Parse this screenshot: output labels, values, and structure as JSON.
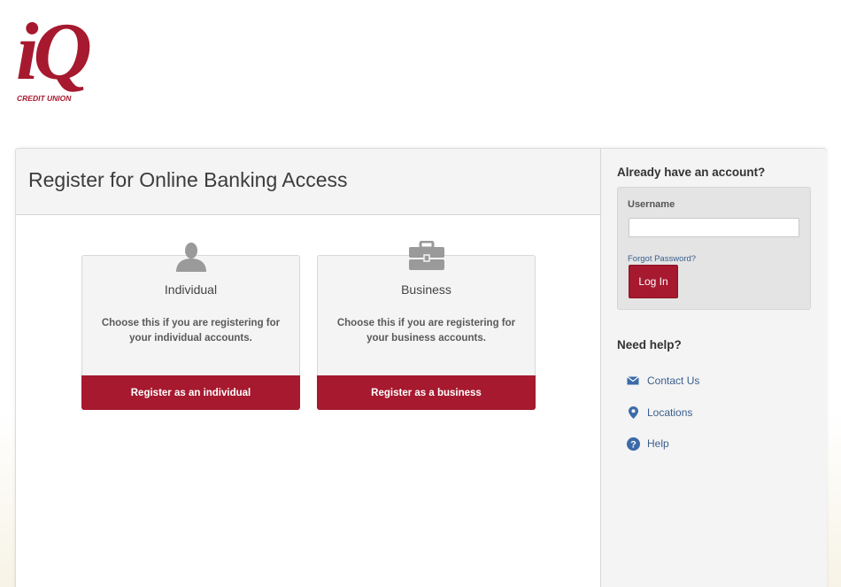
{
  "brand": {
    "logo_text": "iQ",
    "logo_subtext": "CREDIT UNION",
    "color": "#a6192e"
  },
  "main": {
    "title": "Register for Online Banking Access",
    "options": [
      {
        "icon": "person-icon",
        "title": "Individual",
        "description": "Choose this if you are registering for your individual accounts.",
        "button": "Register as an individual"
      },
      {
        "icon": "briefcase-icon",
        "title": "Business",
        "description": "Choose this if you are registering for your business accounts.",
        "button": "Register as a business"
      }
    ]
  },
  "sidebar": {
    "login_heading": "Already have an account?",
    "username_label": "Username",
    "username_value": "",
    "forgot_password": "Forgot Password?",
    "login_button": "Log In",
    "help_heading": "Need help?",
    "help_links": [
      {
        "icon": "envelope-icon",
        "label": "Contact Us"
      },
      {
        "icon": "map-pin-icon",
        "label": "Locations"
      },
      {
        "icon": "question-circle-icon",
        "label": "Help"
      }
    ]
  }
}
